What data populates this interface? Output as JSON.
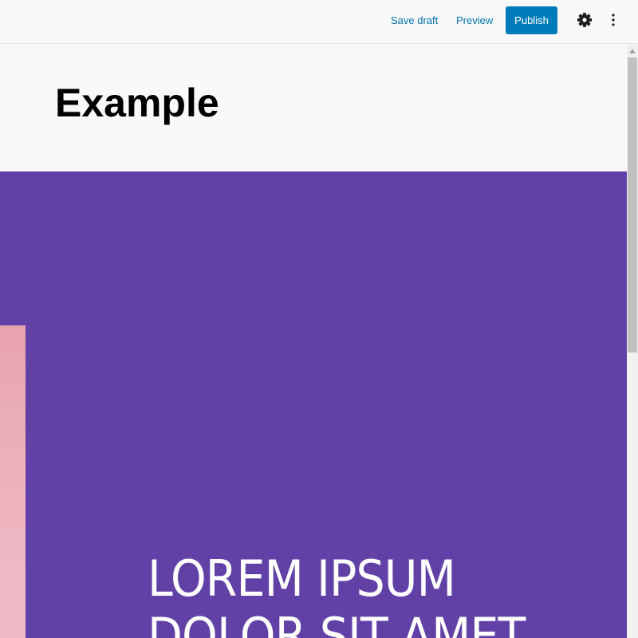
{
  "toolbar": {
    "save_draft_label": "Save draft",
    "preview_label": "Preview",
    "publish_label": "Publish",
    "settings_icon": "gear-icon",
    "more_icon": "more-vertical-icon"
  },
  "editor": {
    "post_title": "Example",
    "cover": {
      "background_color": "#6241a7",
      "text_line_1": "LOREM IPSUM",
      "text_line_2": "DOLOR SIT AMET"
    }
  },
  "colors": {
    "accent": "#007cba",
    "link": "#0073aa"
  }
}
